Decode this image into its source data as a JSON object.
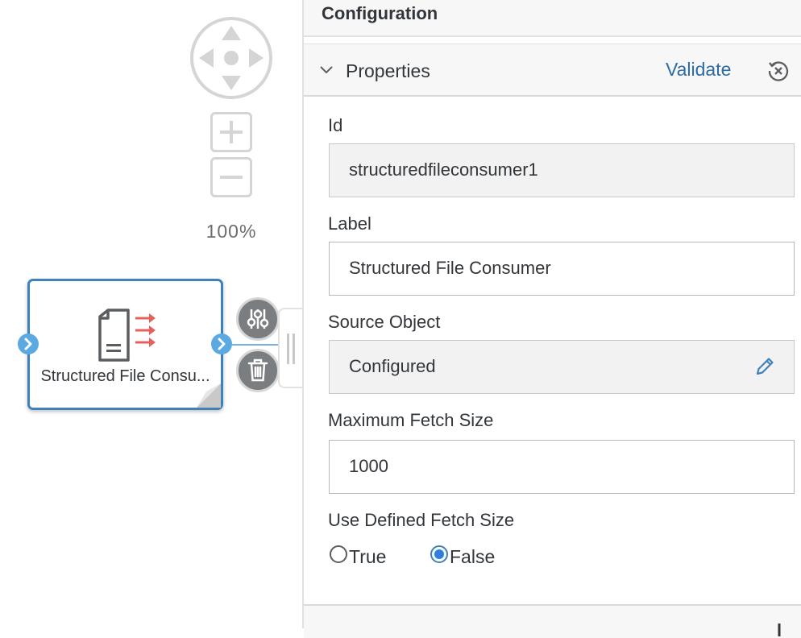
{
  "canvas": {
    "zoom_level": "100%",
    "node": {
      "label": "Structured File Consu...",
      "icon": "structured-file-icon"
    },
    "actions": [
      {
        "name": "configure-node-button",
        "icon": "sliders-icon"
      },
      {
        "name": "delete-node-button",
        "icon": "trash-icon"
      }
    ]
  },
  "panel": {
    "title": "Configuration",
    "section": {
      "title": "Properties",
      "validate_label": "Validate",
      "reset_icon": "reset-icon"
    },
    "fields": {
      "id": {
        "label": "Id",
        "value": "structuredfileconsumer1"
      },
      "label": {
        "label": "Label",
        "value": "Structured File Consumer"
      },
      "source_object": {
        "label": "Source Object",
        "value": "Configured"
      },
      "max_fetch_size": {
        "label": "Maximum Fetch Size",
        "value": "1000"
      },
      "use_defined_fetch_size": {
        "label": "Use Defined Fetch Size",
        "options": [
          "True",
          "False"
        ],
        "selected": "False"
      }
    }
  },
  "colors": {
    "accent": "#3f81b8",
    "link": "#2d6ca2",
    "port": "#5aa9e0",
    "arrow": "#e8605c"
  }
}
